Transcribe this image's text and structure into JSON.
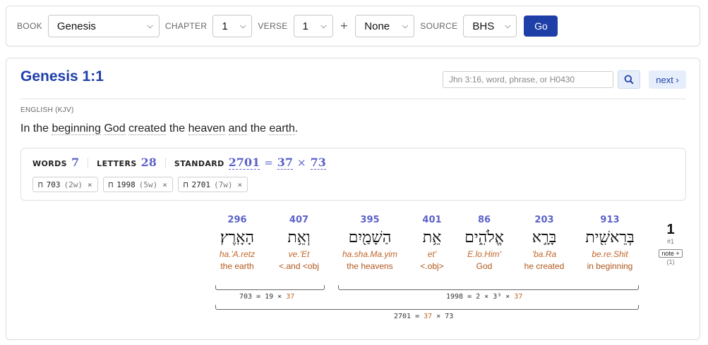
{
  "nav": {
    "book_label": "BOOK",
    "book_value": "Genesis",
    "chapter_label": "CHAPTER",
    "chapter_value": "1",
    "verse_label": "VERSE",
    "verse_value": "1",
    "plus": "+",
    "extra_value": "None",
    "source_label": "SOURCE",
    "source_value": "BHS",
    "go_label": "Go"
  },
  "header": {
    "title": "Genesis 1:1",
    "search_placeholder": "Jhn 3:16, word, phrase, or H0430",
    "next_label": "next ›"
  },
  "english": {
    "label": "ENGLISH (KJV)",
    "words": [
      "In the",
      "beginning",
      "God",
      "created",
      "the",
      "heaven",
      "and",
      "the",
      "earth",
      "."
    ]
  },
  "stats": {
    "words_label": "WORDS",
    "words_value": "7",
    "letters_label": "LETTERS",
    "letters_value": "28",
    "standard_label": "STANDARD",
    "standard_value": "2701",
    "eq": "=",
    "factor1": "37",
    "times": "×",
    "factor2": "73",
    "chips": [
      {
        "value": "703",
        "count": "(2w)"
      },
      {
        "value": "1998",
        "count": "(5w)"
      },
      {
        "value": "2701",
        "count": "(7w)"
      }
    ],
    "chip_prefix": "⊓",
    "chip_close": "×"
  },
  "verse_marker": {
    "number": "1",
    "sub": "#1",
    "note_label": "note +",
    "count": "(1)"
  },
  "hebrew_words": [
    {
      "value": "296",
      "hebrew": "הָאָֽרֶץ׃",
      "translit": "ha.'A.retz",
      "gloss": "the earth"
    },
    {
      "value": "407",
      "hebrew": "וְאֵ֥ת",
      "translit": "ve.'Et",
      "gloss": "<.and <obj"
    },
    {
      "value": "395",
      "hebrew": "הַשָׁמַ֖יִם",
      "translit": "ha.sha.Ma.yim",
      "gloss": "the heavens"
    },
    {
      "value": "401",
      "hebrew": "אֵ֥ת",
      "translit": "et'",
      "gloss": "<.obj>"
    },
    {
      "value": "86",
      "hebrew": "אֱלֹהִ֑ים",
      "translit": "E.lo.Him'",
      "gloss": "God"
    },
    {
      "value": "203",
      "hebrew": "בָּרָ֣א",
      "translit": "'ba.Ra",
      "gloss": "he created"
    },
    {
      "value": "913",
      "hebrew": "בְּרֵאשִׁ֖ית",
      "translit": "be.re.Shit",
      "gloss": "in beginning"
    }
  ],
  "groups": [
    {
      "left": "703 = 19 × ",
      "right": "37"
    },
    {
      "left": "1998 = 2 × 3³ × ",
      "right": "37"
    },
    {
      "left": "2701 = ",
      "mid": "37",
      "tail": " × 73"
    }
  ],
  "colors": {
    "accent": "#1f3fa8",
    "number": "#5b61c9",
    "gloss": "#b0561a"
  }
}
